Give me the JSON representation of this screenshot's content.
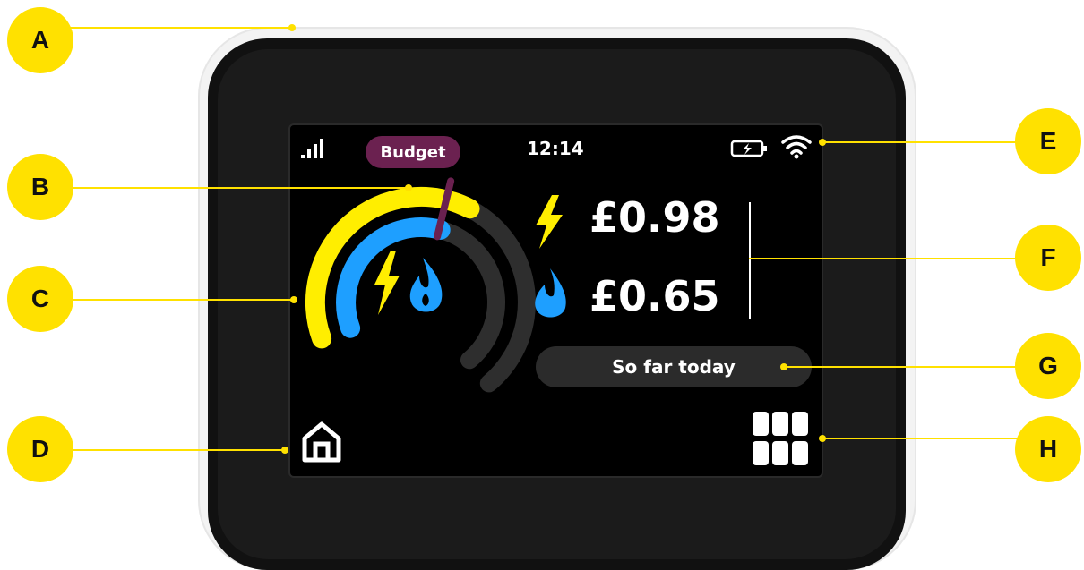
{
  "callouts": [
    {
      "letter": "A"
    },
    {
      "letter": "B"
    },
    {
      "letter": "C"
    },
    {
      "letter": "D"
    },
    {
      "letter": "E"
    },
    {
      "letter": "F"
    },
    {
      "letter": "G"
    },
    {
      "letter": "H"
    }
  ],
  "display": {
    "time": "12:14",
    "budget_label": "Budget",
    "electricity_cost": "£0.98",
    "gas_cost": "£0.65",
    "period_label": "So far today",
    "signal_icon": "signal-bars-icon",
    "battery_icon": "battery-charging-icon",
    "wifi_icon": "wifi-icon",
    "home_icon": "home-icon",
    "menu_icon": "grid-menu-icon",
    "electricity_icon": "lightning-bolt-icon",
    "gas_icon": "gas-flame-icon"
  },
  "gauge": {
    "electricity_fraction": 0.55,
    "gas_fraction": 0.5,
    "budget_fraction": 0.5
  },
  "colors": {
    "callout": "#ffe100",
    "electricity": "#ffee00",
    "gas": "#1e9fff",
    "budget": "#6b2150",
    "track": "#333333"
  }
}
